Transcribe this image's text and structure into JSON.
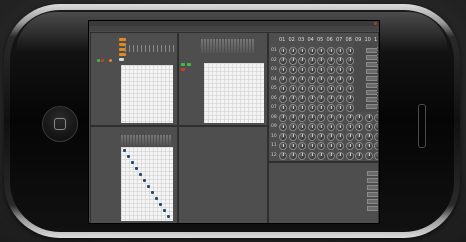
{
  "window": {
    "title": "",
    "menu": [
      "",
      "",
      "",
      "",
      "",
      ""
    ]
  },
  "matrix_panel": {
    "column_headers": [
      "01",
      "02",
      "03",
      "04",
      "05",
      "06",
      "07",
      "08",
      "09",
      "10",
      "11"
    ],
    "row_headers": [
      "01",
      "02",
      "03",
      "04",
      "05",
      "06",
      "07",
      "08",
      "09",
      "10",
      "11",
      "12"
    ]
  },
  "bottom_center_panel": {
    "message": ""
  },
  "colors": {
    "accent_orange": "#e08a1e",
    "accent_green": "#3fbf3f",
    "accent_red": "#d33a2a",
    "diagonal_blue": "#27496d"
  }
}
